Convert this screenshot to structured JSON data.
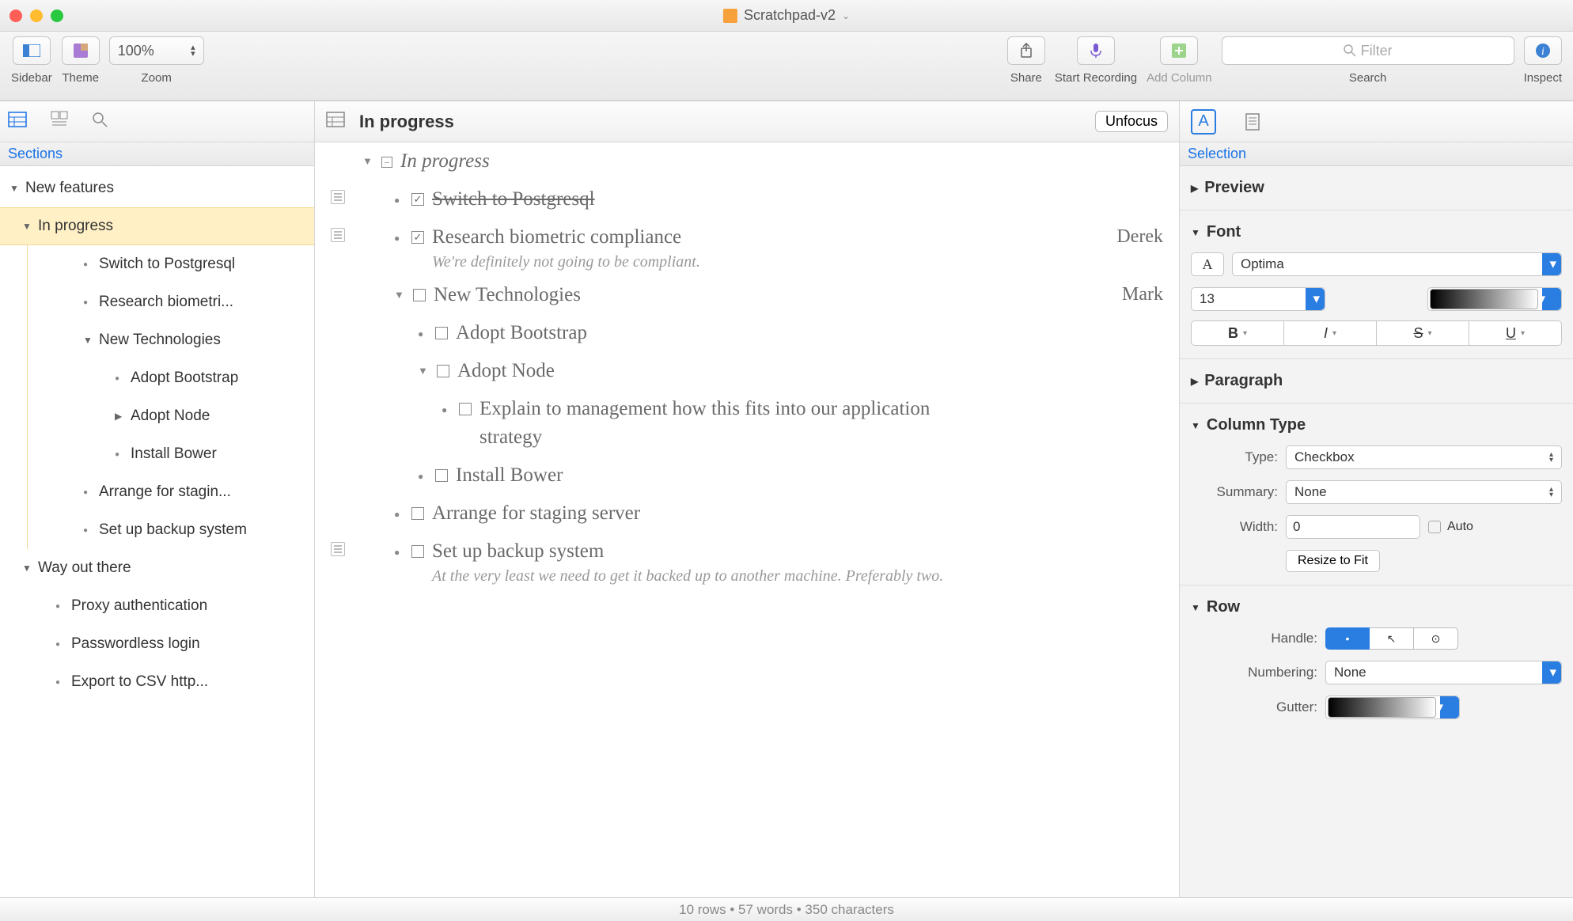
{
  "window": {
    "title": "Scratchpad-v2"
  },
  "toolbar": {
    "sidebar": "Sidebar",
    "theme": "Theme",
    "zoom_label": "Zoom",
    "zoom_value": "100%",
    "share": "Share",
    "start_recording": "Start Recording",
    "add_column": "Add Column",
    "search_label": "Search",
    "filter_placeholder": "Filter",
    "inspect": "Inspect"
  },
  "sidebar": {
    "section_label": "Sections",
    "tree": {
      "new_features": "New features",
      "in_progress": "In progress",
      "switch_pg": "Switch to Postgresql",
      "research_bio": "Research biometri...",
      "new_tech": "New Technologies",
      "adopt_bootstrap": "Adopt Bootstrap",
      "adopt_node": "Adopt Node",
      "install_bower": "Install Bower",
      "arrange_staging": "Arrange for stagin...",
      "setup_backup": "Set up backup system",
      "way_out": "Way out there",
      "proxy_auth": "Proxy authentication",
      "passwordless": "Passwordless login",
      "export_csv": "Export to CSV http..."
    }
  },
  "main": {
    "header_title": "In progress",
    "unfocus": "Unfocus",
    "section_title": "In progress",
    "rows": {
      "switch_pg": "Switch to Postgresql",
      "research_bio": "Research biometric compliance",
      "research_bio_note": "We're definitely not going to be compliant.",
      "research_bio_assignee": "Derek",
      "new_tech": "New Technologies",
      "new_tech_assignee": "Mark",
      "adopt_bootstrap": "Adopt Bootstrap",
      "adopt_node": "Adopt Node",
      "explain_mgmt": "Explain to management how this fits into our application strategy",
      "install_bower": "Install Bower",
      "arrange_staging": "Arrange for staging server",
      "setup_backup": "Set up backup system",
      "setup_backup_note": "At the very least we need to get it backed up to another machine. Preferably two."
    }
  },
  "inspector": {
    "label": "Selection",
    "preview": "Preview",
    "font": "Font",
    "font_name": "Optima",
    "font_size": "13",
    "paragraph": "Paragraph",
    "column_type": "Column Type",
    "type_label": "Type:",
    "type_value": "Checkbox",
    "summary_label": "Summary:",
    "summary_value": "None",
    "width_label": "Width:",
    "width_value": "0",
    "auto": "Auto",
    "resize_fit": "Resize to Fit",
    "row": "Row",
    "handle_label": "Handle:",
    "numbering_label": "Numbering:",
    "numbering_value": "None",
    "gutter_label": "Gutter:"
  },
  "statusbar": {
    "text": "10 rows • 57 words • 350 characters"
  }
}
